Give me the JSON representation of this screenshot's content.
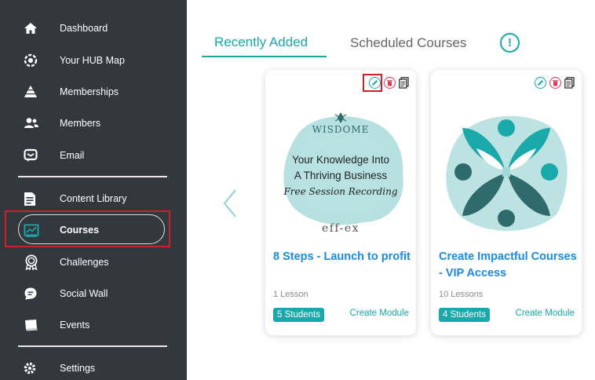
{
  "sidebar": {
    "items": [
      {
        "label": "Dashboard",
        "icon": "home-icon"
      },
      {
        "label": "Your HUB Map",
        "icon": "hub-map-icon"
      },
      {
        "label": "Memberships",
        "icon": "memberships-icon"
      },
      {
        "label": "Members",
        "icon": "members-icon"
      },
      {
        "label": "Email",
        "icon": "email-icon"
      },
      {
        "label": "Content Library",
        "icon": "content-library-icon"
      },
      {
        "label": "Courses",
        "icon": "courses-icon",
        "active": true
      },
      {
        "label": "Challenges",
        "icon": "challenges-icon"
      },
      {
        "label": "Social Wall",
        "icon": "social-wall-icon"
      },
      {
        "label": "Events",
        "icon": "events-icon"
      },
      {
        "label": "Settings",
        "icon": "settings-icon"
      }
    ]
  },
  "tabs": [
    {
      "label": "Recently Added",
      "active": true
    },
    {
      "label": "Scheduled Courses",
      "active": false
    }
  ],
  "info_symbol": "!",
  "courses": [
    {
      "title": "8 Steps - Launch to profit",
      "lessons": "1 Lesson",
      "students": "5 Students",
      "create_module": "Create Module",
      "thumbnail": {
        "brand": "WISDOME",
        "line1": "Your Knowledge Into",
        "line2": "A Thriving Business",
        "line3": "Free Session Recording",
        "footer": "eff-ex"
      }
    },
    {
      "title": "Create Impactful Courses - VIP Access",
      "lessons": "10 Lessons",
      "students": "4 Students",
      "create_module": "Create Module"
    }
  ],
  "colors": {
    "sidebar_bg": "#33383f",
    "accent_teal": "#1aa9ab",
    "title_blue": "#1a8be0",
    "delete_red": "#e23b5a",
    "highlight_red": "#d11f2a"
  }
}
